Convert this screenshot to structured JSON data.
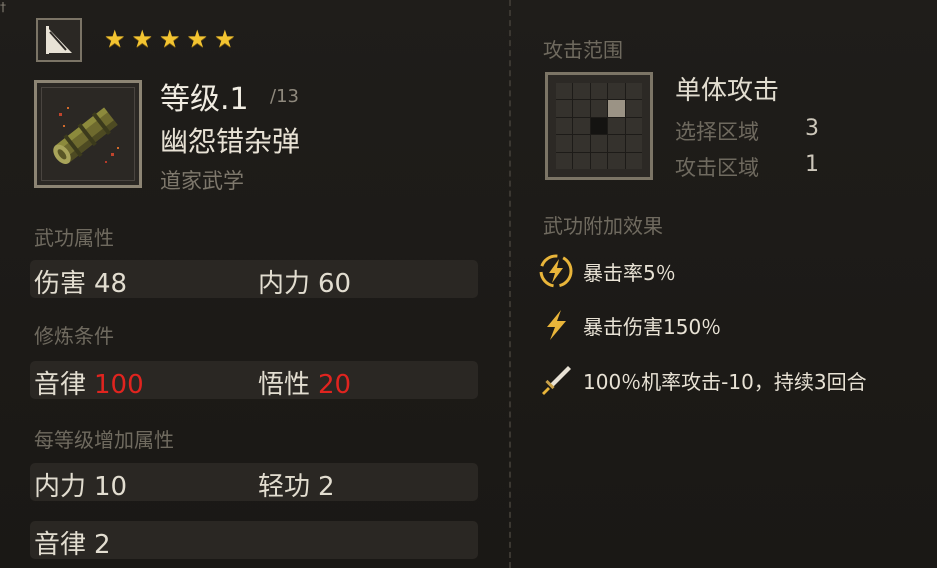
{
  "corner_mark": "†",
  "item": {
    "stars": 5,
    "level": "等级.1",
    "level_max": "/13",
    "name": "幽怨错杂弹",
    "category": "道家武学",
    "type_icon": "flag-icon",
    "image_icon": "scroll-tube-icon"
  },
  "sections": {
    "attributes": "武功属性",
    "requirements": "修炼条件",
    "per_level": "每等级增加属性"
  },
  "attributes": [
    {
      "label": "伤害",
      "value": "48"
    },
    {
      "label": "内力",
      "value": "60"
    }
  ],
  "requirements": [
    {
      "label": "音律",
      "value": "100"
    },
    {
      "label": "悟性",
      "value": "20"
    }
  ],
  "per_level": [
    {
      "label": "内力",
      "value": "10"
    },
    {
      "label": "轻功",
      "value": "2"
    },
    {
      "label": "音律",
      "value": "2"
    }
  ],
  "range": {
    "label": "攻击范围",
    "attack_type": "单体攻击",
    "select_area_label": "选择区域",
    "select_area_value": "3",
    "attack_area_label": "攻击区域",
    "attack_area_value": "1"
  },
  "effects": {
    "label": "武功附加效果",
    "items": [
      {
        "icon": "lightning-circle-icon",
        "text": "暴击率5％"
      },
      {
        "icon": "lightning-icon",
        "text": "暴击伤害150％"
      },
      {
        "icon": "sword-icon",
        "text": "100％机率攻击-10，持续3回合"
      }
    ]
  },
  "colors": {
    "star": "#f3c431",
    "requirement_red": "#e0241f",
    "icon_gold": "#e9b53a"
  }
}
